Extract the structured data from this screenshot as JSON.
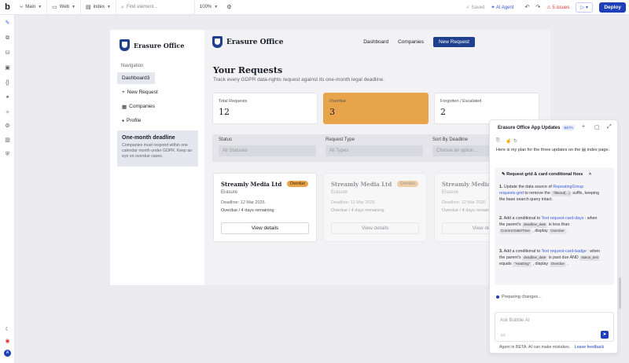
{
  "topbar": {
    "logo": "b",
    "page_label": "Main",
    "device_label": "Web",
    "page_name": "index",
    "search_placeholder": "Find element...",
    "zoom": "100%",
    "saved": "Saved",
    "ai_agent": "AI Agent",
    "issues": "5 issues",
    "deploy": "Deploy"
  },
  "rail": {
    "icons": [
      "pencil-icon",
      "workflow-icon",
      "data-icon",
      "styles-icon",
      "plugins-icon",
      "settings-icon",
      "logs-icon",
      "security-icon"
    ],
    "bottom_icons": [
      "theme-icon",
      "notification-icon",
      "account-icon"
    ],
    "account_letter": "A"
  },
  "sidebar": {
    "brand": "Erasure Office",
    "nav_heading": "Navigation",
    "items": [
      {
        "label": "Dashboard3",
        "icon": ""
      },
      {
        "label": "New Request",
        "icon": "+"
      },
      {
        "label": "Companies",
        "icon": "▦"
      },
      {
        "label": "Profile",
        "icon": "●"
      }
    ],
    "deadline_title": "One-month deadline",
    "deadline_text": "Companies must respond within one calendar month under GDPR. Keep an eye on overdue cases."
  },
  "header": {
    "brand": "Erasure Office",
    "nav": [
      "Dashboard",
      "Companies"
    ],
    "new_request": "New Request"
  },
  "main": {
    "title": "Your Requests",
    "subtitle": "Track every GDPR data-rights request against its one-month legal deadline.",
    "stats": [
      {
        "label": "Total Requests",
        "value": "12"
      },
      {
        "label": "Overdue",
        "value": "3"
      },
      {
        "label": "Forgotten / Escalated",
        "value": "2"
      }
    ],
    "filters": {
      "status_label": "Status",
      "status_value": "All Statuses",
      "type_label": "Request Type",
      "type_value": "All Types",
      "sort_label": "Sort By Deadline",
      "sort_value": "Choose an option..."
    },
    "cards": [
      {
        "company": "Streamly Media Ltd",
        "badge": "Overdue",
        "type": "Erasure",
        "deadline": "Deadline: 12 Mar 2026",
        "remaining": "Overdue / 4 days remaining",
        "button": "View details"
      },
      {
        "company": "Streamly Media Ltd",
        "badge": "Overdue",
        "type": "Erasure",
        "deadline": "Deadline: 12 Mar 2026",
        "remaining": "Overdue / 4 days remaining",
        "button": "View details"
      },
      {
        "company": "Streamly Media Ltd",
        "badge": "",
        "type": "Erasure",
        "deadline": "Deadline: 12 Mar 2026",
        "remaining": "Overdue / 4 days remaining",
        "button": "View details"
      }
    ]
  },
  "ai_panel": {
    "title": "Erasure Office App Updates",
    "beta": "BETA",
    "intro_a": "Here is my plan for the three updates on the",
    "intro_page": "index",
    "intro_b": "page.",
    "section_title": "Request grid & card conditional fixes",
    "steps": [
      {
        "num": "1.",
        "a": "Update the data source of",
        "ref": "RepeatingGroup requests-grid",
        "b": "to remove the",
        "chip": ":filtered(...)",
        "c": "suffix, keeping the base search query intact."
      },
      {
        "num": "2.",
        "a": "Add a conditional to",
        "ref": "Text request-card-days",
        "b": ": when the parent's",
        "chip": "deadline_date",
        "c": "is less than",
        "chip2": "Current Date/Time",
        "d": ", display",
        "chip3": "Overdue",
        "e": "."
      },
      {
        "num": "3.",
        "a": "Add a conditional to",
        "ref": "Text request-card-badge",
        "b": ": when the parent's",
        "chip": "deadline_date",
        "c": "is past due AND",
        "chip2": "status_text",
        "d": "equals",
        "chip3": "\"Awaiting\"",
        "e": ", display",
        "chip4": "Overdue",
        "f": "."
      }
    ],
    "status": "Preparing changes...",
    "input_placeholder": "Ask Bubble AI",
    "footer": "Agent in BETA. AI can make mistakes.",
    "footer_link": "Leave feedback"
  }
}
